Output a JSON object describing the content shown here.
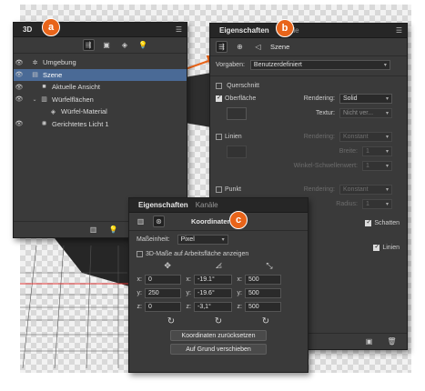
{
  "badges": {
    "a": "a",
    "b": "b",
    "c": "c"
  },
  "panel3d": {
    "title": "3D",
    "items": [
      {
        "label": "Umgebung",
        "icon": "environment-icon",
        "selected": false,
        "eye": true
      },
      {
        "label": "Szene",
        "icon": "scene-icon",
        "selected": true,
        "eye": true
      },
      {
        "label": "Aktuelle Ansicht",
        "icon": "camera-icon",
        "selected": false,
        "eye": true
      },
      {
        "label": "Würfelflächen",
        "icon": "cube-icon",
        "selected": false,
        "eye": true
      },
      {
        "label": "Würfel-Material",
        "icon": "material-icon",
        "selected": false,
        "eye": false
      },
      {
        "label": "Gerichtetes Licht 1",
        "icon": "light-icon",
        "selected": false,
        "eye": true
      }
    ]
  },
  "props": {
    "tab_active": "Eigenschaften",
    "tab_other": "Kanäle",
    "toolbar_label": "Szene",
    "vorgaben_label": "Vorgaben:",
    "vorgaben_value": "Benutzerdefiniert",
    "querschnitt": "Querschnitt",
    "oberflaeche": "Oberfläche",
    "rendering_label": "Rendering:",
    "rendering_value": "Solid",
    "textur_label": "Textur:",
    "textur_value": "Nicht ver...",
    "linien": "Linien",
    "linien_rendering_value": "Konstant",
    "breite_label": "Breite:",
    "breite_value": "1",
    "winkel_label": "Winkel-Schwellenwert:",
    "winkel_value": "1",
    "punkt": "Punkt",
    "punkt_rendering_value": "Konstant",
    "radius_label": "Radius:",
    "radius_value": "1",
    "schatten": "Schatten",
    "linien2": "Linien"
  },
  "coords": {
    "tab_active": "Eigenschaften",
    "tab_other": "Kanäle",
    "toolbar_label": "Koordinaten",
    "masseinheit_label": "Maßeinheit:",
    "masseinheit_value": "Pixel",
    "checkbox_label": "3D-Maße auf Arbeitsfläche anzeigen",
    "rows": [
      {
        "a_label": "x:",
        "a": "0",
        "b_label": "x:",
        "b": "-19.1°",
        "c_label": "x:",
        "c": "500"
      },
      {
        "a_label": "y:",
        "a": "250",
        "b_label": "y:",
        "b": "-19.6°",
        "c_label": "y:",
        "c": "500"
      },
      {
        "a_label": "z:",
        "a": "0",
        "b_label": "z:",
        "b": "-3,1°",
        "c_label": "z:",
        "c": "500"
      }
    ],
    "reset_button": "Koordinaten zurücksetzen",
    "ground_button": "Auf Grund verschieben"
  }
}
